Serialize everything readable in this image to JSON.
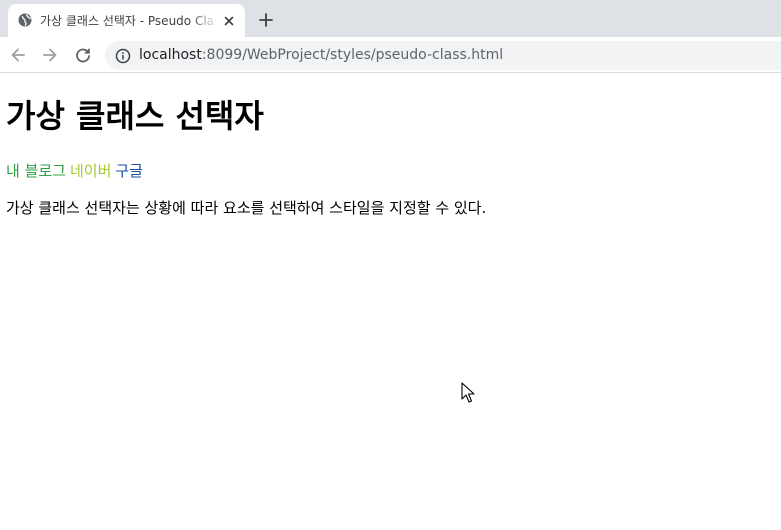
{
  "browser": {
    "tab": {
      "title": "가상 클래스 선택자 - Pseudo Class"
    },
    "address": {
      "host": "localhost",
      "rest": ":8099/WebProject/styles/pseudo-class.html"
    }
  },
  "page": {
    "heading": "가상 클래스 선택자",
    "links": [
      {
        "label": "내 블로그",
        "color": "#2ea043"
      },
      {
        "label": "네이버",
        "color": "#a6c930"
      },
      {
        "label": "구글",
        "color": "#1a4da1"
      }
    ],
    "paragraph": "가상 클래스 선택자는 상황에 따라 요소를 선택하여 스타일을 지정할 수 있다."
  },
  "icons": {
    "favicon": "globe-icon",
    "close": "close-icon",
    "new_tab": "plus-icon",
    "back": "back-arrow-icon",
    "forward": "forward-arrow-icon",
    "reload": "reload-icon",
    "info": "info-icon",
    "cursor": "mouse-pointer-icon"
  }
}
